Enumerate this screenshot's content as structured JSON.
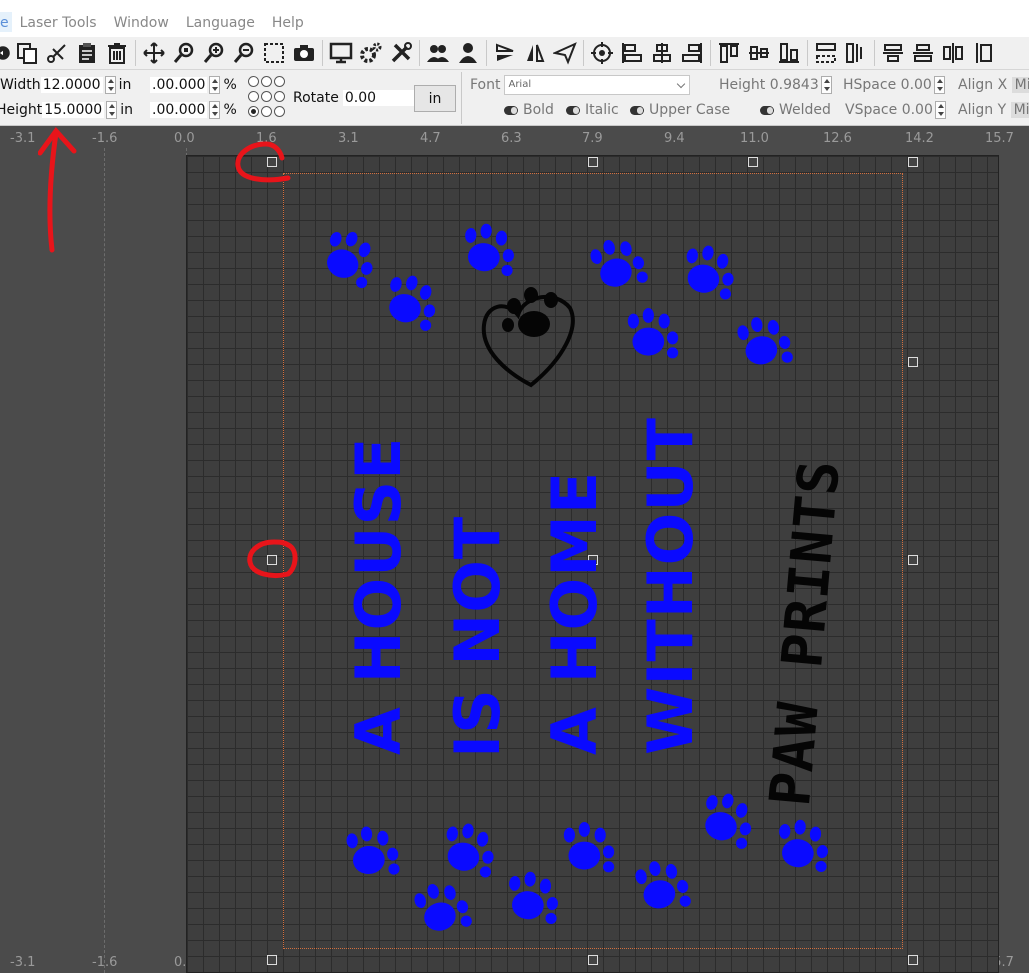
{
  "menu": [
    "e",
    "Laser Tools",
    "Window",
    "Language",
    "Help"
  ],
  "toolbar_icons": [
    "undo-icon",
    "copy-icon",
    "cut-icon",
    "paste-icon",
    "delete-icon",
    "move-icon",
    "zoom-page-icon",
    "zoom-in-icon",
    "zoom-out-icon",
    "zoom-frame-icon",
    "camera-icon",
    "monitor-icon",
    "settings-icon",
    "tools-icon",
    "group-icon",
    "user-icon",
    "flip-vertical-icon",
    "flip-horizontal-icon",
    "send-icon",
    "target-icon",
    "align-left-icon",
    "align-center-icon",
    "align-right-icon",
    "align-top-icon",
    "align-middle-icon",
    "align-bottom-icon",
    "distribute-icon",
    "distribute-h-icon",
    "align-v-icon",
    "align-vc-icon",
    "distribute-v-icon",
    "more-icon"
  ],
  "props": {
    "width_label": "Width",
    "width_value": "12.0000",
    "height_label": "Height",
    "height_value": "15.0000",
    "unit": "in",
    "scale_w": ".00.000",
    "scale_h": ".00.000",
    "percent": "%",
    "rotate_label": "Rotate",
    "rotate_value": "0.00",
    "unit_button": "in",
    "font_label": "Font",
    "font_value": "Arial",
    "text_height_label": "Height",
    "text_height_value": "0.9843",
    "hspace_label": "HSpace",
    "hspace_value": "0.00",
    "align_x_label": "Align X",
    "align_x_value": "Mid",
    "bold": "Bold",
    "italic": "Italic",
    "upper_case": "Upper Case",
    "welded": "Welded",
    "vspace_label": "VSpace",
    "vspace_value": "0.00",
    "align_y_label": "Align Y",
    "align_y_value": "Mid"
  },
  "ruler_labels": [
    "-3.1",
    "-1.6",
    "0.0",
    "1.6",
    "3.1",
    "4.7",
    "6.3",
    "7.9",
    "9.4",
    "11.0",
    "12.6",
    "14.2",
    "15.7"
  ],
  "design": {
    "lines": [
      "A HOUSE",
      "IS NOT",
      "A HOME",
      "WITHOUT"
    ],
    "last_line": "PAW PRINTS",
    "text_color": "#0a0aff",
    "accent_color": "#050505"
  },
  "annotation_color": "#e8141a"
}
